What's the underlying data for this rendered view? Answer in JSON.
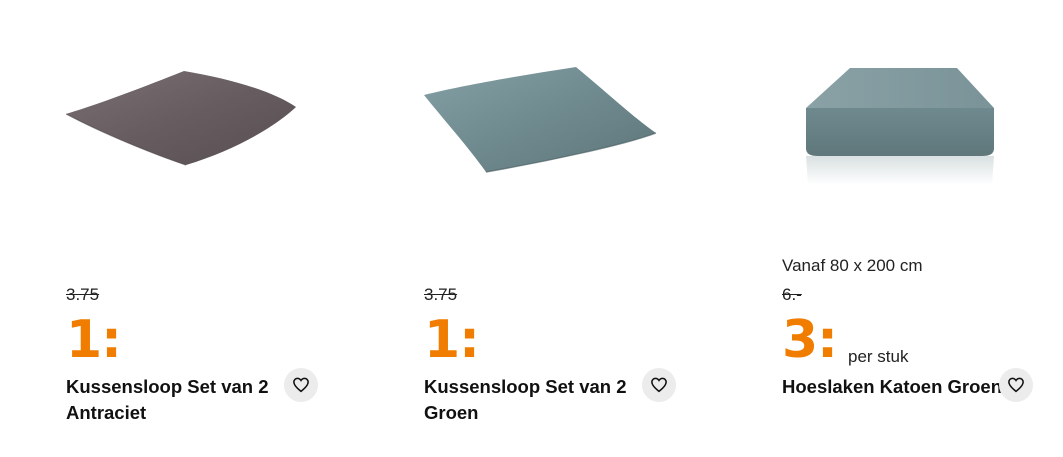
{
  "products": [
    {
      "image_icon": "pillowcase-anthracite-image",
      "old_price": "3.75",
      "price": "1:",
      "title": "Kussensloop Set van 2 Antraciet",
      "favorite_icon": "heart-icon"
    },
    {
      "image_icon": "pillowcase-green-image",
      "old_price": "3.75",
      "price": "1:",
      "title": "Kussensloop Set van 2 Groen",
      "favorite_icon": "heart-icon"
    },
    {
      "image_icon": "fitted-sheet-green-image",
      "size_note": "Vanaf 80 x 200 cm",
      "old_price": "6.-",
      "price": "3:",
      "per_unit": "per stuk",
      "title": "Hoeslaken Katoen Groen",
      "favorite_icon": "heart-icon"
    }
  ],
  "colors": {
    "price": "#f07c00",
    "anthracite": "#6b6164",
    "green": "#6f8a8f",
    "fav_bg": "#ececec"
  }
}
